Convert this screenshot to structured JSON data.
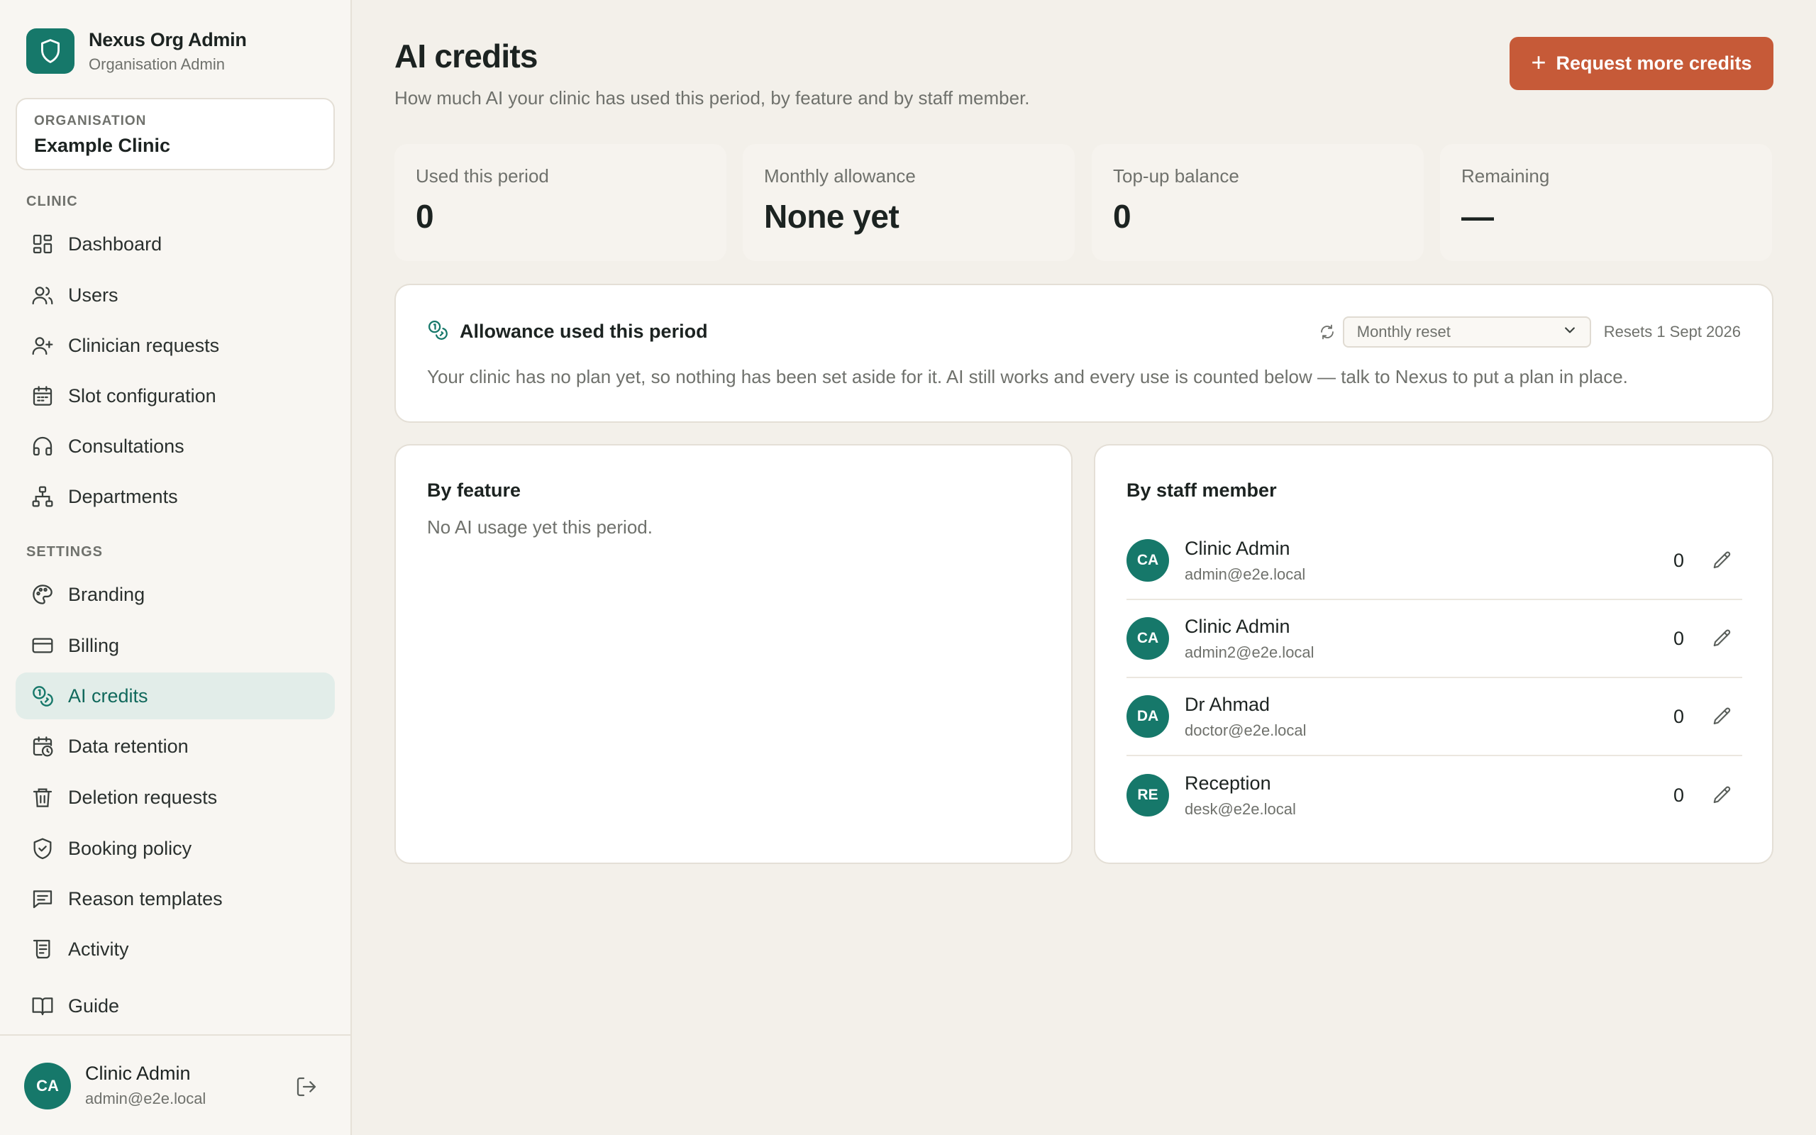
{
  "brand": {
    "title": "Nexus Org Admin",
    "subtitle": "Organisation Admin",
    "logo_icon": "shield-icon"
  },
  "organisation": {
    "label": "ORGANISATION",
    "name": "Example Clinic"
  },
  "sidebar": {
    "clinic_label": "CLINIC",
    "clinic_items": [
      {
        "label": "Dashboard",
        "icon": "dashboard-icon"
      },
      {
        "label": "Users",
        "icon": "users-icon"
      },
      {
        "label": "Clinician requests",
        "icon": "user-plus-icon"
      },
      {
        "label": "Slot configuration",
        "icon": "calendar-icon"
      },
      {
        "label": "Consultations",
        "icon": "headphones-icon"
      },
      {
        "label": "Departments",
        "icon": "hierarchy-icon"
      }
    ],
    "settings_label": "SETTINGS",
    "settings_items": [
      {
        "label": "Branding",
        "icon": "palette-icon"
      },
      {
        "label": "Billing",
        "icon": "credit-card-icon"
      },
      {
        "label": "AI credits",
        "icon": "coins-icon",
        "active": true
      },
      {
        "label": "Data retention",
        "icon": "calendar-clock-icon"
      },
      {
        "label": "Deletion requests",
        "icon": "trash-icon"
      },
      {
        "label": "Booking policy",
        "icon": "shield-check-icon"
      },
      {
        "label": "Reason templates",
        "icon": "message-icon"
      },
      {
        "label": "Activity",
        "icon": "scroll-icon"
      }
    ],
    "guide": {
      "label": "Guide",
      "icon": "book-icon"
    }
  },
  "current_user": {
    "initials": "CA",
    "name": "Clinic Admin",
    "email": "admin@e2e.local"
  },
  "page": {
    "title": "AI credits",
    "subtitle": "How much AI your clinic has used this period, by feature and by staff member.",
    "request_button": "Request more credits"
  },
  "stats": [
    {
      "label": "Used this period",
      "value": "0"
    },
    {
      "label": "Monthly allowance",
      "value": "None yet"
    },
    {
      "label": "Top-up balance",
      "value": "0"
    },
    {
      "label": "Remaining",
      "value": "—"
    }
  ],
  "allowance": {
    "title": "Allowance used this period",
    "reset_option": "Monthly reset",
    "resets_text": "Resets 1 Sept 2026",
    "description": "Your clinic has no plan yet, so nothing has been set aside for it. AI still works and every use is counted below — talk to Nexus to put a plan in place."
  },
  "by_feature": {
    "title": "By feature",
    "empty_text": "No AI usage yet this period."
  },
  "by_staff": {
    "title": "By staff member",
    "members": [
      {
        "initials": "CA",
        "name": "Clinic Admin",
        "email": "admin@e2e.local",
        "count": "0"
      },
      {
        "initials": "CA",
        "name": "Clinic Admin",
        "email": "admin2@e2e.local",
        "count": "0"
      },
      {
        "initials": "DA",
        "name": "Dr Ahmad",
        "email": "doctor@e2e.local",
        "count": "0"
      },
      {
        "initials": "RE",
        "name": "Reception",
        "email": "desk@e2e.local",
        "count": "0"
      }
    ]
  },
  "colors": {
    "accent": "#16786a",
    "cta": "#c65a38",
    "active_bg": "#e2ede9"
  }
}
